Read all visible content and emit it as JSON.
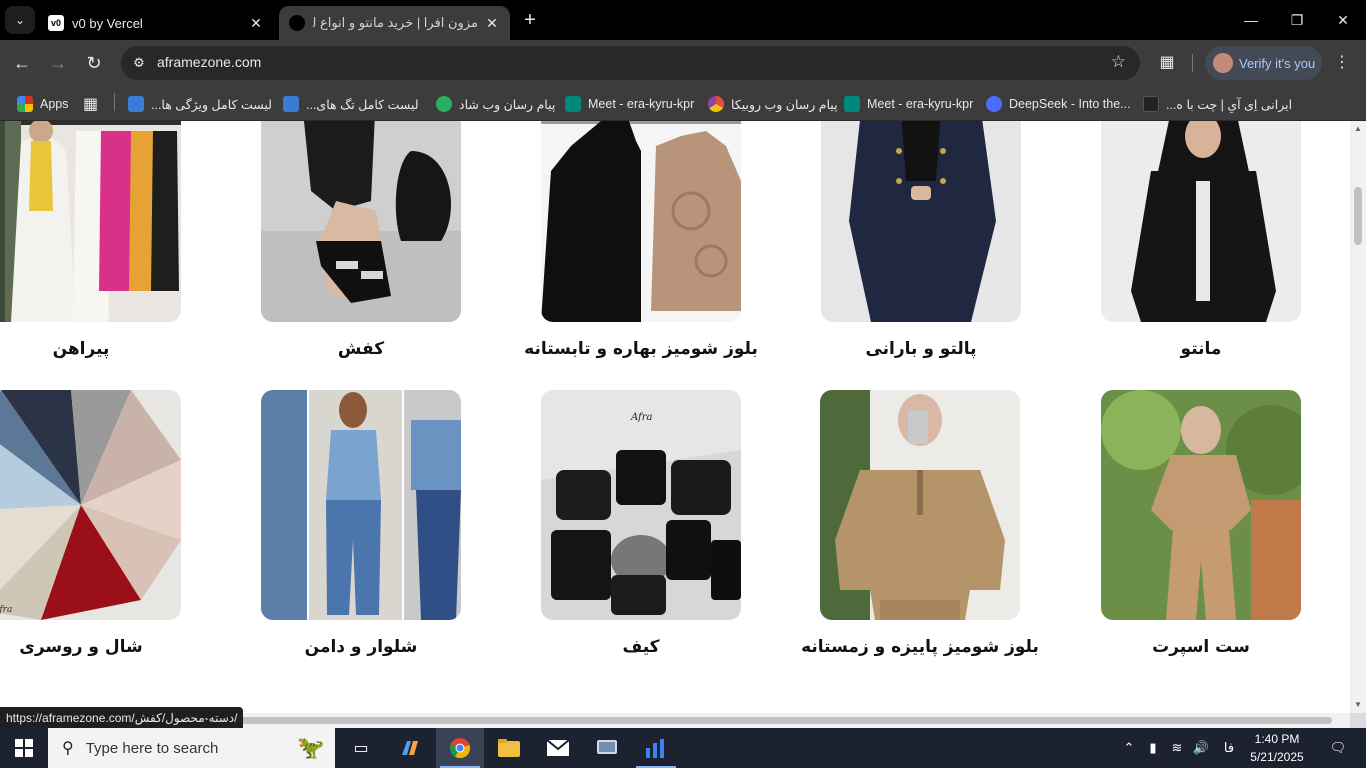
{
  "browser": {
    "tabs": [
      {
        "title": "v0 by Vercel",
        "favicon": "v0-icon"
      },
      {
        "title": "مزون افرا | خرید مانتو و انواع لباس",
        "favicon": "site-icon"
      }
    ],
    "url": "aframezone.com",
    "verify_label": "Verify it's you",
    "bookmarks": [
      {
        "label": "Apps",
        "icon": "apps-grid-icon",
        "color": "#d95c3a"
      },
      {
        "label": "لیست کامل ویژگی ها...",
        "icon": "bookmark-icon",
        "color": "#3a7bd5"
      },
      {
        "label": "لیست کامل تگ های...",
        "icon": "bookmark-icon",
        "color": "#3a7bd5"
      },
      {
        "label": "پیام رسان وب شاد",
        "icon": "shad-icon",
        "color": "#27ae60"
      },
      {
        "label": "Meet - era-kyru-kpr",
        "icon": "meet-icon",
        "color": "#00897b"
      },
      {
        "label": "پیام رسان وب روبیکا",
        "icon": "rubika-icon",
        "color": "#8e44ad"
      },
      {
        "label": "Meet - era-kyru-kpr",
        "icon": "meet-icon",
        "color": "#00897b"
      },
      {
        "label": "DeepSeek - Into the...",
        "icon": "deepseek-icon",
        "color": "#4d6bfe"
      },
      {
        "label": "ایرانی اِی آیِ | چت با ه...",
        "icon": "ai-icon",
        "color": "#222222"
      }
    ],
    "status_url": "https://aframezone.com/دسته-محصول/کفش/"
  },
  "categories": {
    "row1": [
      {
        "label": "پیراهن",
        "name": "category-dress"
      },
      {
        "label": "کفش",
        "name": "category-shoes"
      },
      {
        "label": "بلوز شومیز بهاره و تابستانه",
        "name": "category-spring-summer-blouse"
      },
      {
        "label": "پالتو و بارانی",
        "name": "category-coat"
      },
      {
        "label": "مانتو",
        "name": "category-manteau"
      }
    ],
    "row2": [
      {
        "label": "شال و روسری",
        "name": "category-scarf"
      },
      {
        "label": "شلوار و دامن",
        "name": "category-pants-skirt"
      },
      {
        "label": "کیف",
        "name": "category-bag"
      },
      {
        "label": "بلوز شومیز پاییزه و زمستانه",
        "name": "category-autumn-winter-blouse"
      },
      {
        "label": "ست اسپرت",
        "name": "category-sport-set"
      }
    ],
    "image_watermark": "Afra"
  },
  "taskbar": {
    "search_placeholder": "Type here to search",
    "language": "فا",
    "time": "1:40 PM",
    "date": "5/21/2025"
  }
}
